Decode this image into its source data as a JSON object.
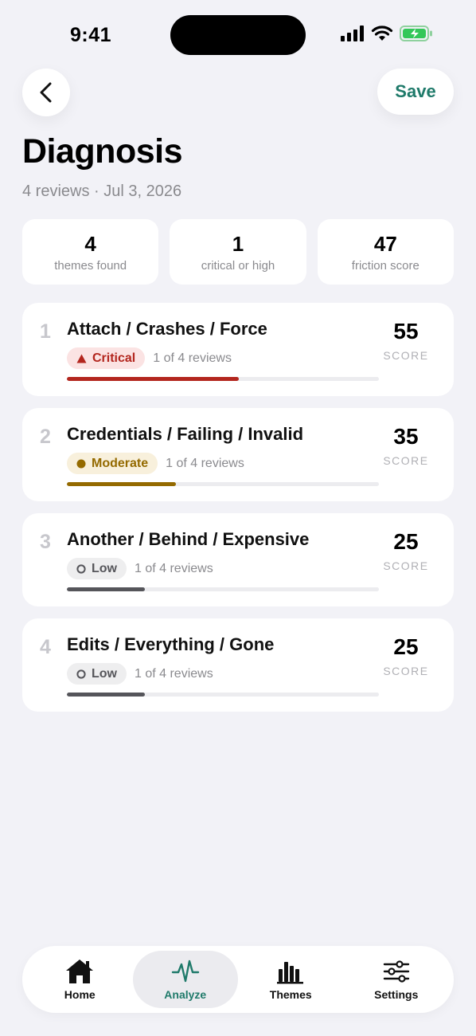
{
  "status_bar": {
    "time": "9:41"
  },
  "header": {
    "save_label": "Save",
    "title": "Diagnosis",
    "subtitle": "4 reviews · Jul 3, 2026"
  },
  "stats": [
    {
      "value": "4",
      "label": "themes found"
    },
    {
      "value": "1",
      "label": "critical or high"
    },
    {
      "value": "47",
      "label": "friction score"
    }
  ],
  "themes": [
    {
      "rank": "1",
      "title": "Attach / Crashes / Force",
      "severity": "Critical",
      "reviews": "1 of 4 reviews",
      "score": "55",
      "score_label": "SCORE",
      "fill": 0.55
    },
    {
      "rank": "2",
      "title": "Credentials / Failing / Invalid",
      "severity": "Moderate",
      "reviews": "1 of 4 reviews",
      "score": "35",
      "score_label": "SCORE",
      "fill": 0.35
    },
    {
      "rank": "3",
      "title": "Another / Behind / Expensive",
      "severity": "Low",
      "reviews": "1 of 4 reviews",
      "score": "25",
      "score_label": "SCORE",
      "fill": 0.25
    },
    {
      "rank": "4",
      "title": "Edits / Everything / Gone",
      "severity": "Low",
      "reviews": "1 of 4 reviews",
      "score": "25",
      "score_label": "SCORE",
      "fill": 0.25
    }
  ],
  "colors": {
    "accent": "#1f7a6a",
    "critical": "#b3261e",
    "moderate": "#946a00",
    "low": "#55555a"
  },
  "tabs": [
    {
      "label": "Home",
      "icon": "house-icon",
      "active": false
    },
    {
      "label": "Analyze",
      "icon": "pulse-icon",
      "active": true
    },
    {
      "label": "Themes",
      "icon": "bar-chart-icon",
      "active": false
    },
    {
      "label": "Settings",
      "icon": "sliders-icon",
      "active": false
    }
  ]
}
